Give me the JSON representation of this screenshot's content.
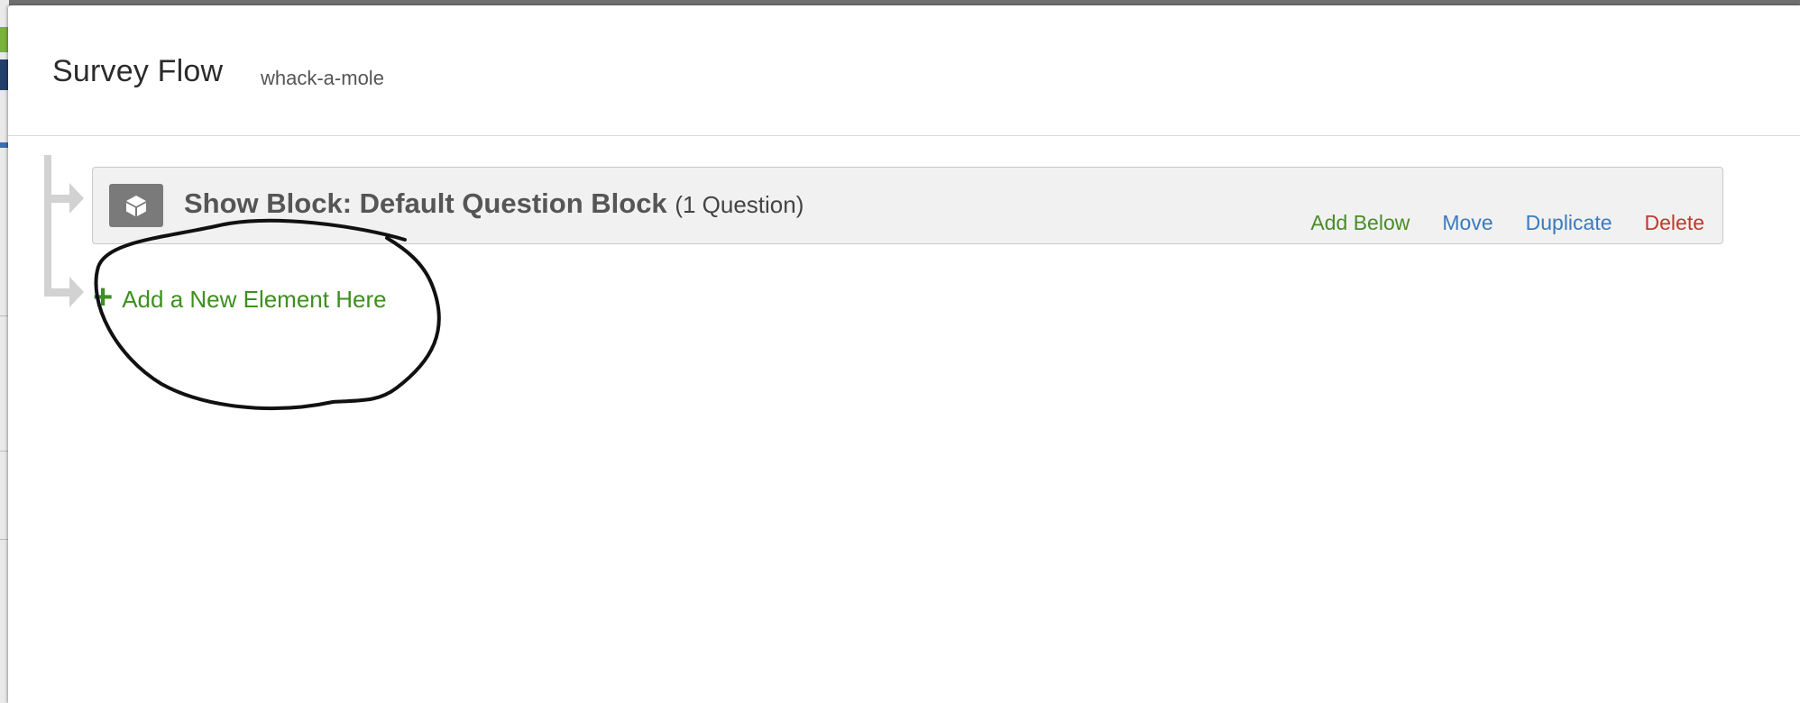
{
  "dialog": {
    "title": "Survey Flow",
    "subtitle": "whack-a-mole"
  },
  "block": {
    "icon": "cube-icon",
    "title": "Show Block: Default Question Block",
    "count": "(1 Question)",
    "actions": {
      "add_below": "Add Below",
      "move": "Move",
      "duplicate": "Duplicate",
      "delete": "Delete"
    }
  },
  "add_element": {
    "icon": "plus-icon",
    "label": "Add a New Element Here"
  },
  "colors": {
    "add_green": "#3e8f1f",
    "link_blue": "#3a7abf",
    "delete_red": "#c0392b",
    "block_bg": "#f1f1f1"
  }
}
